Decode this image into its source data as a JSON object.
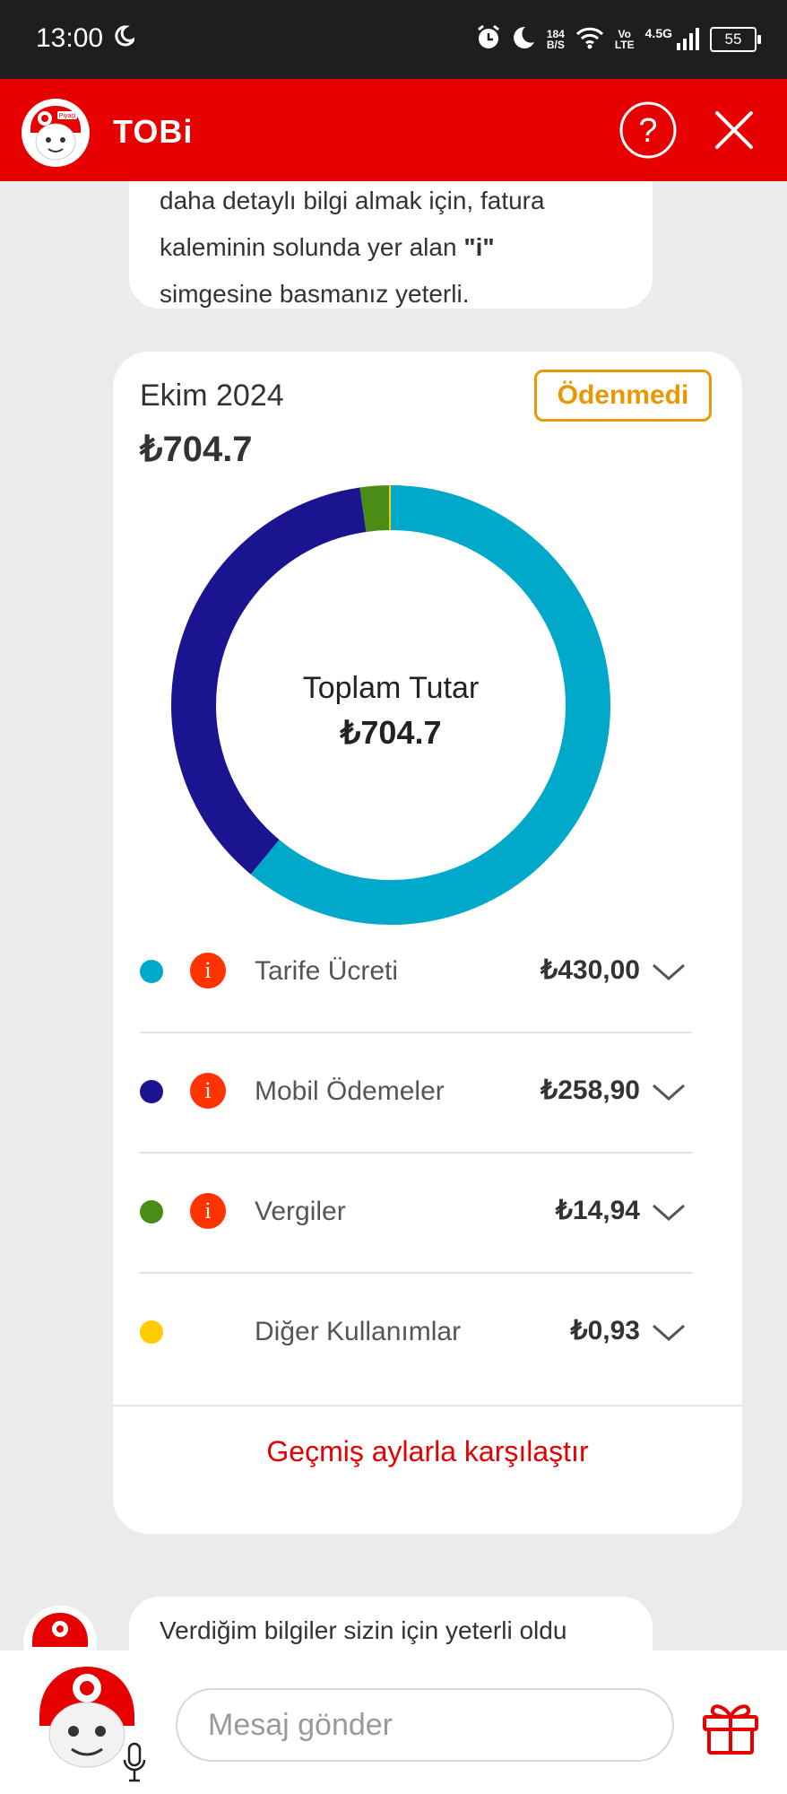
{
  "status_bar": {
    "time": "13:00",
    "net_speed_value": "184",
    "net_speed_unit": "B/S",
    "volte_top": "Vo",
    "volte_bottom": "LTE",
    "network_type": "4.5G",
    "battery_level": "55",
    "icons": [
      "moon-icon",
      "alarm-icon",
      "moon-icon",
      "wifi-icon",
      "signal-icon",
      "battery-icon"
    ]
  },
  "header": {
    "title": "TOBi",
    "logo_text": "Piyaşi",
    "help_icon": "help-icon",
    "close_icon": "close-icon"
  },
  "chat_top_bubble": {
    "line1": "daha detaylı bilgi almak için, fatura",
    "line2_pre": "kaleminin solunda yer alan ",
    "line2_bold": "\"i\"",
    "line3": "simgesine basmanız yeterli."
  },
  "bill_card": {
    "period": "Ekim 2024",
    "amount": "₺704.7",
    "status": "Ödenmedi",
    "center_label": "Toplam Tutar",
    "center_value": "₺704.7",
    "compare_link": "Geçmiş aylarla karşılaştır",
    "items": [
      {
        "label": "Tarife Ücreti",
        "value": "₺430,00",
        "color": "#00a9c9",
        "has_info": true
      },
      {
        "label": "Mobil Ödemeler",
        "value": "₺258,90",
        "color": "#1a1490",
        "has_info": true
      },
      {
        "label": "Vergiler",
        "value": "₺14,94",
        "color": "#4b8c16",
        "has_info": true
      },
      {
        "label": "Diğer Kullanımlar",
        "value": "₺0,93",
        "color": "#ffcc00",
        "has_info": false
      }
    ]
  },
  "chart_data": {
    "type": "pie",
    "style": "donut",
    "categories": [
      "Tarife Ücreti",
      "Mobil Ödemeler",
      "Vergiler",
      "Diğer Kullanımlar"
    ],
    "values": [
      430.0,
      258.9,
      14.94,
      0.93
    ],
    "colors": [
      "#00a9c9",
      "#1a1490",
      "#4b8c16",
      "#ffcc00"
    ],
    "center_label": "Toplam Tutar",
    "center_value": "₺704.7"
  },
  "chat_bottom_bubble": {
    "text": "Verdiğim bilgiler sizin için yeterli oldu"
  },
  "input_bar": {
    "placeholder": "Mesaj gönder",
    "value": "",
    "mic_icon": "microphone-icon",
    "gift_icon": "gift-icon"
  },
  "colors": {
    "brand_red": "#e60000",
    "status_orange": "#eb9700",
    "info_red": "#ff3300"
  }
}
